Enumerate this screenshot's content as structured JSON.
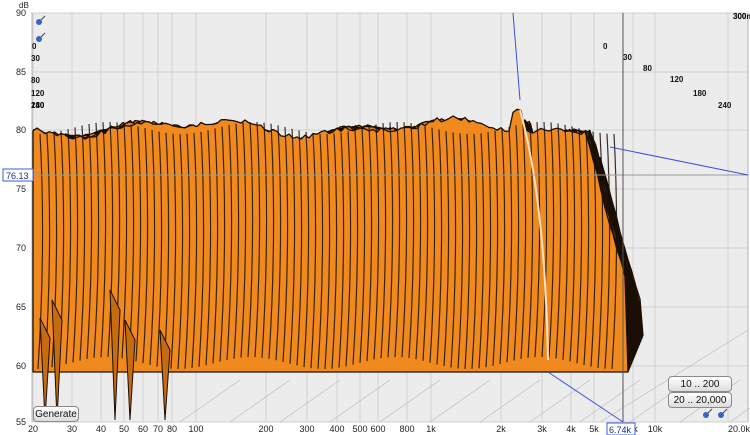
{
  "chart_data": {
    "type": "waterfall",
    "y_axis": {
      "unit_label": "dB",
      "ticks": [
        "90",
        "85",
        "80",
        "75",
        "70",
        "65",
        "60",
        "55"
      ],
      "range": [
        55,
        90
      ]
    },
    "x_axis": {
      "ticks": [
        "20",
        "30",
        "40",
        "50",
        "60",
        "70",
        "80",
        "100",
        "200",
        "300",
        "400",
        "500",
        "600",
        "800",
        "1k",
        "2k",
        "3k",
        "4k",
        "5k",
        "8k",
        "10k",
        "20.0kHz"
      ]
    },
    "time_axis": {
      "ticks": [
        "0",
        "30",
        "80",
        "120",
        "180",
        "240",
        "300",
        "300ms"
      ],
      "range_ms": [
        0,
        300
      ]
    },
    "cursor": {
      "level_label": "76.13",
      "frequency_label": "6.74k"
    },
    "surface_color": "#f08a1e",
    "outline_color": "#1a0f05"
  },
  "controls": {
    "generate_label": "Generate",
    "range_a_label": "10 .. 200",
    "range_b_label": "20 .. 20,000"
  }
}
